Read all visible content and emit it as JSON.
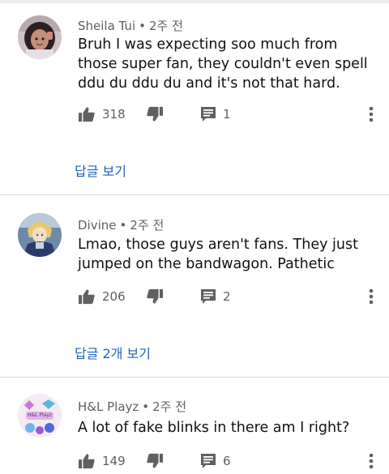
{
  "comments": [
    {
      "author": "Sheila Tui",
      "time": "2주 전",
      "separator": "•",
      "text": "Bruh I was expecting soo much from those super fan, they couldn't even spell ddu du ddu du and it's not that hard.",
      "likes": "318",
      "replies": "1",
      "reply_link": "답글 보기"
    },
    {
      "author": "Divine",
      "time": "2주 전",
      "separator": "•",
      "text": "Lmao, those guys aren't fans. They just jumped on the bandwagon. Pathetic",
      "likes": "206",
      "replies": "2",
      "reply_link": "답글 2개 보기"
    },
    {
      "author": "H&L Playz",
      "time": "2주 전",
      "separator": "•",
      "text": "A lot of fake blinks in there am I right?",
      "likes": "149",
      "replies": "6"
    }
  ],
  "avatar_badge_text": "H&L Playz",
  "icons": {
    "like": "thumbs-up-icon",
    "dislike": "thumbs-down-icon",
    "reply": "comment-icon",
    "more": "more-vert-icon"
  },
  "colors": {
    "link": "#1c62b9",
    "meta": "#606060",
    "text": "#111111",
    "icon": "#606060"
  }
}
